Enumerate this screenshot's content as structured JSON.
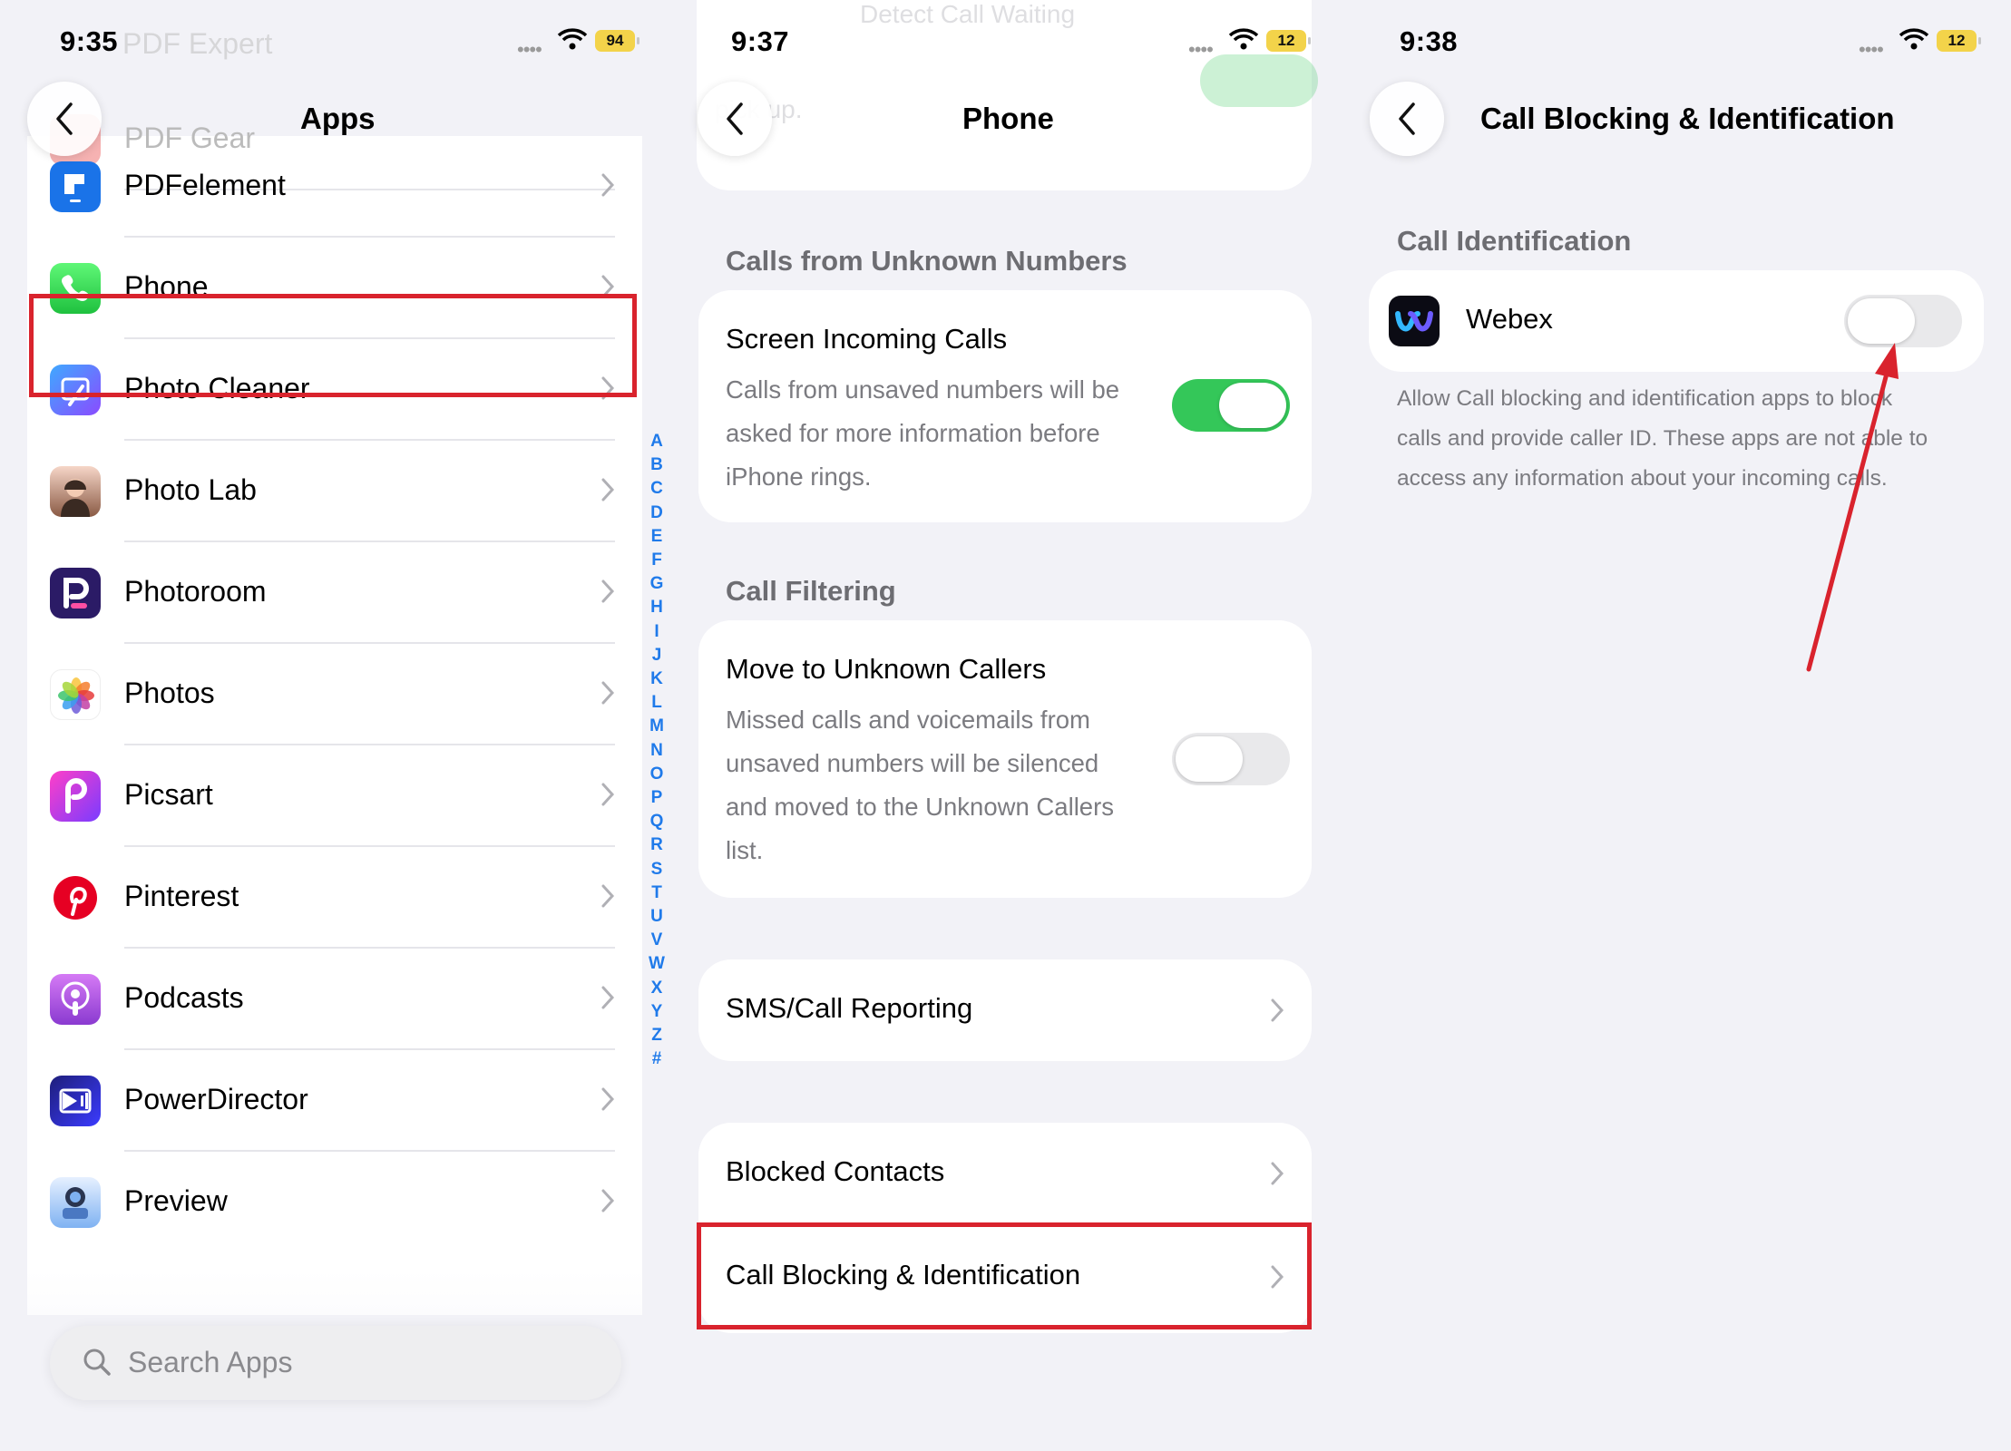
{
  "panel1": {
    "status": {
      "time": "9:35",
      "battery": "94"
    },
    "title": "Apps",
    "ghost_above": [
      "PDF Expert",
      "PDF Gear"
    ],
    "apps": [
      {
        "label": "PDFelement",
        "icon": "pdfelement-icon"
      },
      {
        "label": "Phone",
        "icon": "phone-app-icon"
      },
      {
        "label": "Photo Cleaner",
        "icon": "photo-cleaner-icon"
      },
      {
        "label": "Photo Lab",
        "icon": "photo-lab-icon"
      },
      {
        "label": "Photoroom",
        "icon": "photoroom-icon"
      },
      {
        "label": "Photos",
        "icon": "photos-icon"
      },
      {
        "label": "Picsart",
        "icon": "picsart-icon"
      },
      {
        "label": "Pinterest",
        "icon": "pinterest-icon"
      },
      {
        "label": "Podcasts",
        "icon": "podcasts-icon"
      },
      {
        "label": "PowerDirector",
        "icon": "powerdirector-icon"
      },
      {
        "label": "Preview",
        "icon": "preview-icon"
      }
    ],
    "index": [
      "A",
      "B",
      "C",
      "D",
      "E",
      "F",
      "G",
      "H",
      "I",
      "J",
      "K",
      "L",
      "M",
      "N",
      "O",
      "P",
      "Q",
      "R",
      "S",
      "T",
      "U",
      "V",
      "W",
      "X",
      "Y",
      "Z",
      "#"
    ],
    "search_placeholder": "Search Apps"
  },
  "panel2": {
    "status": {
      "time": "9:37",
      "battery": "12"
    },
    "title": "Phone",
    "ghost_top": [
      "Detect Call Waiting",
      "",
      "",
      "pick up."
    ],
    "unknown_section": "Calls from Unknown Numbers",
    "screen_calls": {
      "title": "Screen Incoming Calls",
      "desc": [
        "Calls from unsaved numbers will be",
        "asked for more information before",
        "iPhone rings."
      ],
      "on": true
    },
    "filter_section": "Call Filtering",
    "move_unknown": {
      "title": "Move to Unknown Callers",
      "desc": [
        "Missed calls and voicemails from",
        "unsaved numbers will be silenced",
        "and moved to the Unknown Callers",
        "list."
      ],
      "on": false
    },
    "sms_report": "SMS/Call Reporting",
    "blocked_contacts": "Blocked Contacts",
    "call_blocking": "Call Blocking & Identification"
  },
  "panel3": {
    "status": {
      "time": "9:38",
      "battery": "12"
    },
    "title": "Call Blocking & Identification",
    "section": "Call Identification",
    "app": {
      "label": "Webex",
      "on": false
    },
    "footnote": [
      "Allow Call blocking and identification apps to block",
      "calls and provide caller ID. These apps are not able to",
      "access any information about your incoming calls."
    ]
  },
  "colors": {
    "toggle_on": "#34c759",
    "toggle_off": "#e9e9eb",
    "highlight": "#d9232d",
    "index": "#1f7aea"
  }
}
